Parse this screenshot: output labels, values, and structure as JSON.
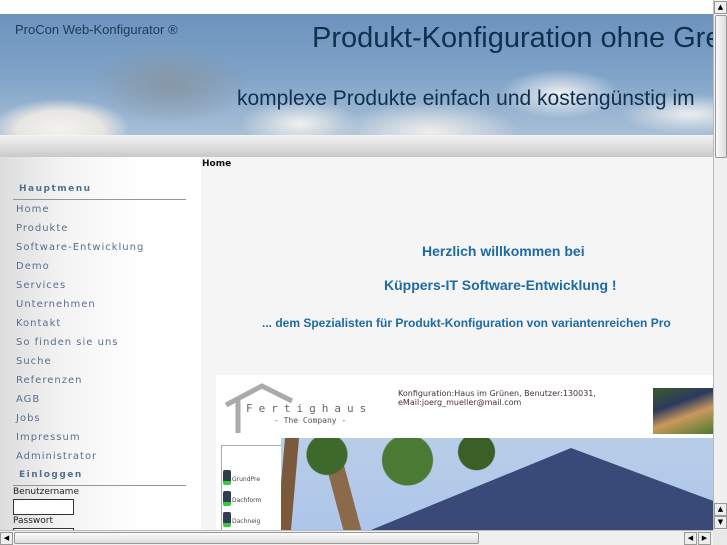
{
  "banner": {
    "brand": "ProCon Web-Konfigurator ®",
    "headline": "Produkt-Konfiguration ohne Gre",
    "subline": "komplexe Produkte einfach und kostengünstig im"
  },
  "sidebar": {
    "main_menu_title": "Hauptmenu",
    "items": [
      "Home",
      "Produkte",
      "Software-Entwicklung",
      "Demo",
      "Services",
      "Unternehmen",
      "Kontakt",
      "So finden sie uns",
      "Suche",
      "Referenzen",
      "AGB",
      "Jobs",
      "Impressum",
      "Administrator"
    ],
    "login_title": "Einloggen",
    "username_label": "Benutzername",
    "username_value": "",
    "password_label": "Passwort"
  },
  "content": {
    "breadcrumb": "Home",
    "welcome_line1": "Herzlich willkommen bei",
    "welcome_line2": "Küppers-IT Software-Entwicklung !",
    "welcome_line3": "... dem Spezialisten für Produkt-Konfiguration von variantenreichen Pro",
    "demo": {
      "logo_title": "Fertighaus",
      "logo_sub": "- The Company -",
      "config_line1": "Konfiguration:Haus im Grünen, Benutzer:130031,",
      "config_line2": "eMail:joerg_mueller@mail.com",
      "rows": [
        "GrundPre",
        "Dachform",
        "Dachneig"
      ]
    }
  },
  "colors": {
    "accent": "#1d6aa4",
    "menu": "#5a6f8e"
  }
}
